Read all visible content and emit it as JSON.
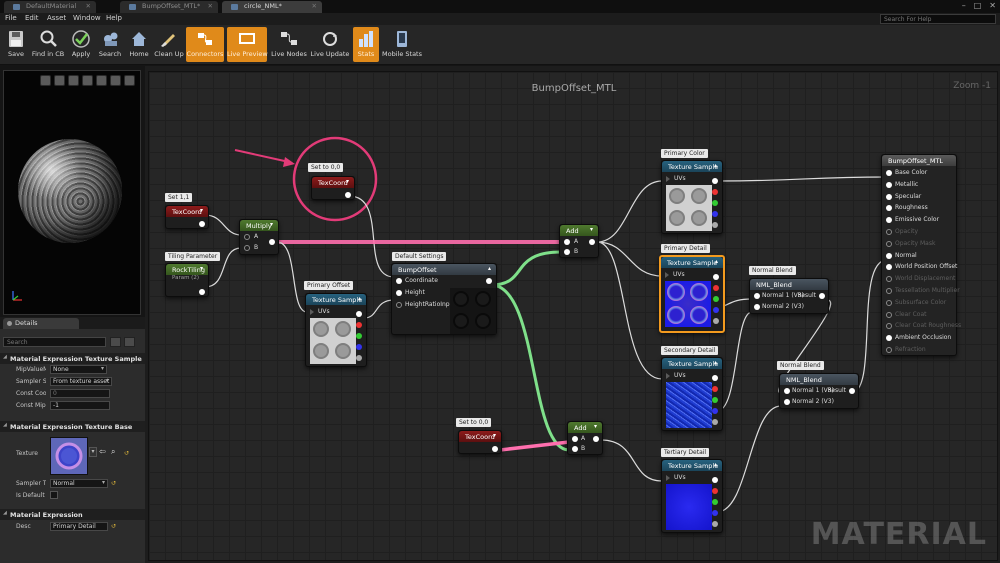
{
  "tabs": [
    {
      "label": "DefaultMaterial"
    },
    {
      "label": "BumpOffset_MTL*"
    },
    {
      "label": "circle_NML*"
    }
  ],
  "menu": [
    "File",
    "Edit",
    "Asset",
    "Window",
    "Help"
  ],
  "help_search_placeholder": "Search For Help",
  "toolbar": [
    {
      "label": "Save",
      "icon": "save-icon",
      "active": false
    },
    {
      "label": "Find in CB",
      "icon": "find-in-cb-icon",
      "active": false
    },
    {
      "label": "Apply",
      "icon": "apply-icon",
      "active": false
    },
    {
      "label": "Search",
      "icon": "search-icon",
      "active": false
    },
    {
      "label": "Home",
      "icon": "home-icon",
      "active": false
    },
    {
      "label": "Clean Up",
      "icon": "clean-up-icon",
      "active": false
    },
    {
      "label": "Connectors",
      "icon": "connectors-icon",
      "active": true
    },
    {
      "label": "Live Preview",
      "icon": "live-preview-icon",
      "active": true
    },
    {
      "label": "Live Nodes",
      "icon": "live-nodes-icon",
      "active": false
    },
    {
      "label": "Live Update",
      "icon": "live-update-icon",
      "active": false
    },
    {
      "label": "Stats",
      "icon": "stats-icon",
      "active": true
    },
    {
      "label": "Mobile Stats",
      "icon": "mobile-stats-icon",
      "active": false
    }
  ],
  "details": {
    "tab_label": "Details",
    "search_placeholder": "Search",
    "sections": {
      "texture_sample": {
        "title": "Material Expression Texture Sample",
        "props": [
          {
            "label": "MipValueM",
            "value": "None"
          },
          {
            "label": "Sampler So",
            "value": "From texture asset"
          },
          {
            "label": "Const Coord",
            "value": "0"
          },
          {
            "label": "Const Mip V",
            "value": "-1"
          }
        ]
      },
      "texture_base": {
        "title": "Material Expression Texture Base",
        "texture_label": "Texture",
        "sampler_type_label": "Sampler Ty",
        "sampler_type_value": "Normal",
        "is_default_label": "Is Default N"
      },
      "expression": {
        "title": "Material Expression",
        "desc_label": "Desc",
        "desc_value": "Primary Detail"
      }
    }
  },
  "graph": {
    "title": "BumpOffset_MTL",
    "zoom": "Zoom -1",
    "watermark": "MATERIAL",
    "colors": {
      "comment_circle": "#e23b78",
      "arrow": "#e23b78",
      "selected_outline": "#f39a1e",
      "wire_highlight_pink": "#ff6fae",
      "wire_highlight_green": "#7fe08a"
    },
    "comments": {
      "set00_a": "Set to 0,0",
      "set11": "Set 1,1",
      "tiling": "Tiling Parameter",
      "default_settings": "Default Settings",
      "primary_offset": "Primary Offset",
      "primary_color": "Primary Color",
      "primary_detail": "Primary Detail",
      "secondary_detail": "Secondary Detail",
      "tertiary_detail": "Tertiary Detail",
      "normal_blend_1": "Normal Blend",
      "normal_blend_2": "Normal Blend",
      "set00_b": "Set to 0,0"
    },
    "nodes": {
      "texcoord_top": {
        "title": "TexCoord"
      },
      "texcoord_left": {
        "title": "TexCoord"
      },
      "texcoord_bottom": {
        "title": "TexCoord"
      },
      "rock_tiling": {
        "title": "RockTiling",
        "sub": "Param (2)"
      },
      "multiply": {
        "title": "Multiply",
        "pins": [
          "A",
          "B"
        ]
      },
      "add_top": {
        "title": "Add",
        "pins": [
          "A",
          "B"
        ]
      },
      "add_bottom": {
        "title": "Add",
        "pins": [
          "A",
          "B"
        ]
      },
      "bump_offset": {
        "title": "BumpOffset",
        "pins": [
          "Coordinate",
          "Height",
          "HeightRatioInput"
        ]
      },
      "ts_primary_offset": {
        "title": "Texture Sample",
        "pin": "UVs"
      },
      "ts_primary_color": {
        "title": "Texture Sample",
        "pin": "UVs"
      },
      "ts_primary_detail": {
        "title": "Texture Sample",
        "pin": "UVs"
      },
      "ts_secondary": {
        "title": "Texture Sample",
        "pin": "UVs"
      },
      "ts_tertiary": {
        "title": "Texture Sample",
        "pin": "UVs"
      },
      "nml_blend_1": {
        "title": "NML_Blend",
        "pins": [
          "Normal 1 (V3)",
          "Normal 2 (V3)"
        ],
        "out": "Result"
      },
      "nml_blend_2": {
        "title": "NML_Blend",
        "pins": [
          "Normal 1 (V3)",
          "Normal 2 (V3)"
        ],
        "out": "Result"
      },
      "result": {
        "title": "BumpOffset_MTL",
        "pins": [
          {
            "label": "Base Color",
            "active": true
          },
          {
            "label": "Metallic",
            "active": true
          },
          {
            "label": "Specular",
            "active": true
          },
          {
            "label": "Roughness",
            "active": true
          },
          {
            "label": "Emissive Color",
            "active": true
          },
          {
            "label": "Opacity",
            "active": false
          },
          {
            "label": "Opacity Mask",
            "active": false
          },
          {
            "label": "Normal",
            "active": true
          },
          {
            "label": "World Position Offset",
            "active": true
          },
          {
            "label": "World Displacement",
            "active": false
          },
          {
            "label": "Tessellation Multiplier",
            "active": false
          },
          {
            "label": "Subsurface Color",
            "active": false
          },
          {
            "label": "Clear Coat",
            "active": false
          },
          {
            "label": "Clear Coat Roughness",
            "active": false
          },
          {
            "label": "Ambient Occlusion",
            "active": true
          },
          {
            "label": "Refraction",
            "active": false
          }
        ]
      }
    }
  }
}
